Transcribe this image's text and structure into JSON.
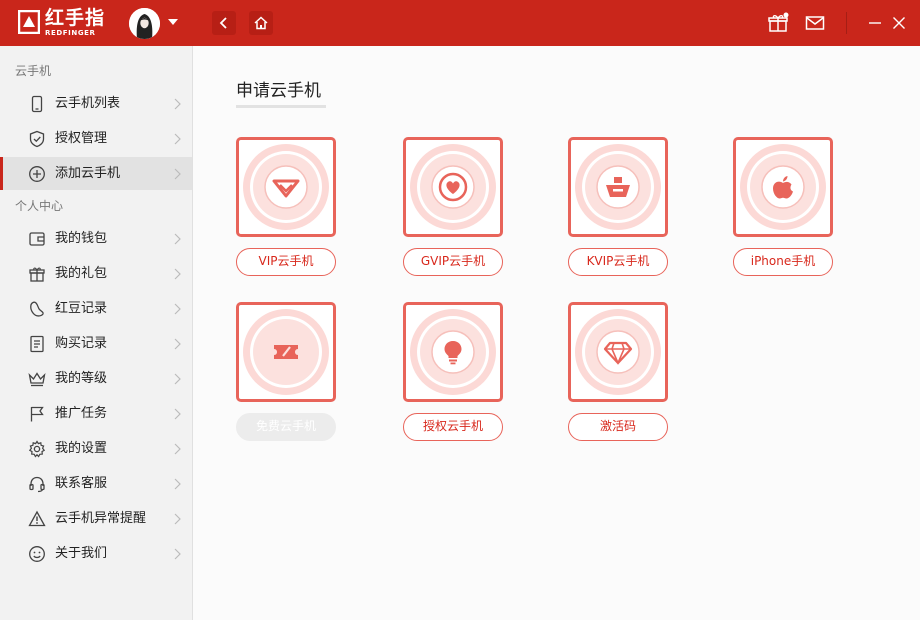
{
  "app": {
    "logo_text": "红手指",
    "logo_sub": "REDFINGER"
  },
  "colors": {
    "brand_red": "#c9261b",
    "card_border": "#e8645a",
    "card_glyph": "#e8645a",
    "pill_text": "#d8281c"
  },
  "sidebar": {
    "section1_title": "云手机",
    "section2_title": "个人中心",
    "items": [
      {
        "label": "云手机列表",
        "icon": "phone-icon"
      },
      {
        "label": "授权管理",
        "icon": "shield-icon"
      },
      {
        "label": "添加云手机",
        "icon": "add-circle-icon",
        "active": true
      },
      {
        "label": "我的钱包",
        "icon": "wallet-icon"
      },
      {
        "label": "我的礼包",
        "icon": "gift-icon"
      },
      {
        "label": "红豆记录",
        "icon": "bean-icon"
      },
      {
        "label": "购买记录",
        "icon": "receipt-icon"
      },
      {
        "label": "我的等级",
        "icon": "crown-icon"
      },
      {
        "label": "推广任务",
        "icon": "flag-icon"
      },
      {
        "label": "我的设置",
        "icon": "gear-icon"
      },
      {
        "label": "联系客服",
        "icon": "headset-icon"
      },
      {
        "label": "云手机异常提醒",
        "icon": "warning-icon"
      },
      {
        "label": "关于我们",
        "icon": "smile-icon"
      }
    ]
  },
  "main": {
    "title": "申请云手机",
    "options": [
      {
        "label": "VIP云手机",
        "icon": "vip-diamond-icon"
      },
      {
        "label": "GVIP云手机",
        "icon": "heart-icon"
      },
      {
        "label": "KVIP云手机",
        "icon": "crown-basket-icon"
      },
      {
        "label": "iPhone手机",
        "icon": "apple-icon"
      },
      {
        "label": "免费云手机",
        "icon": "ticket-icon",
        "disabled": true
      },
      {
        "label": "授权云手机",
        "icon": "bulb-icon"
      },
      {
        "label": "激活码",
        "icon": "gem-icon"
      }
    ]
  }
}
